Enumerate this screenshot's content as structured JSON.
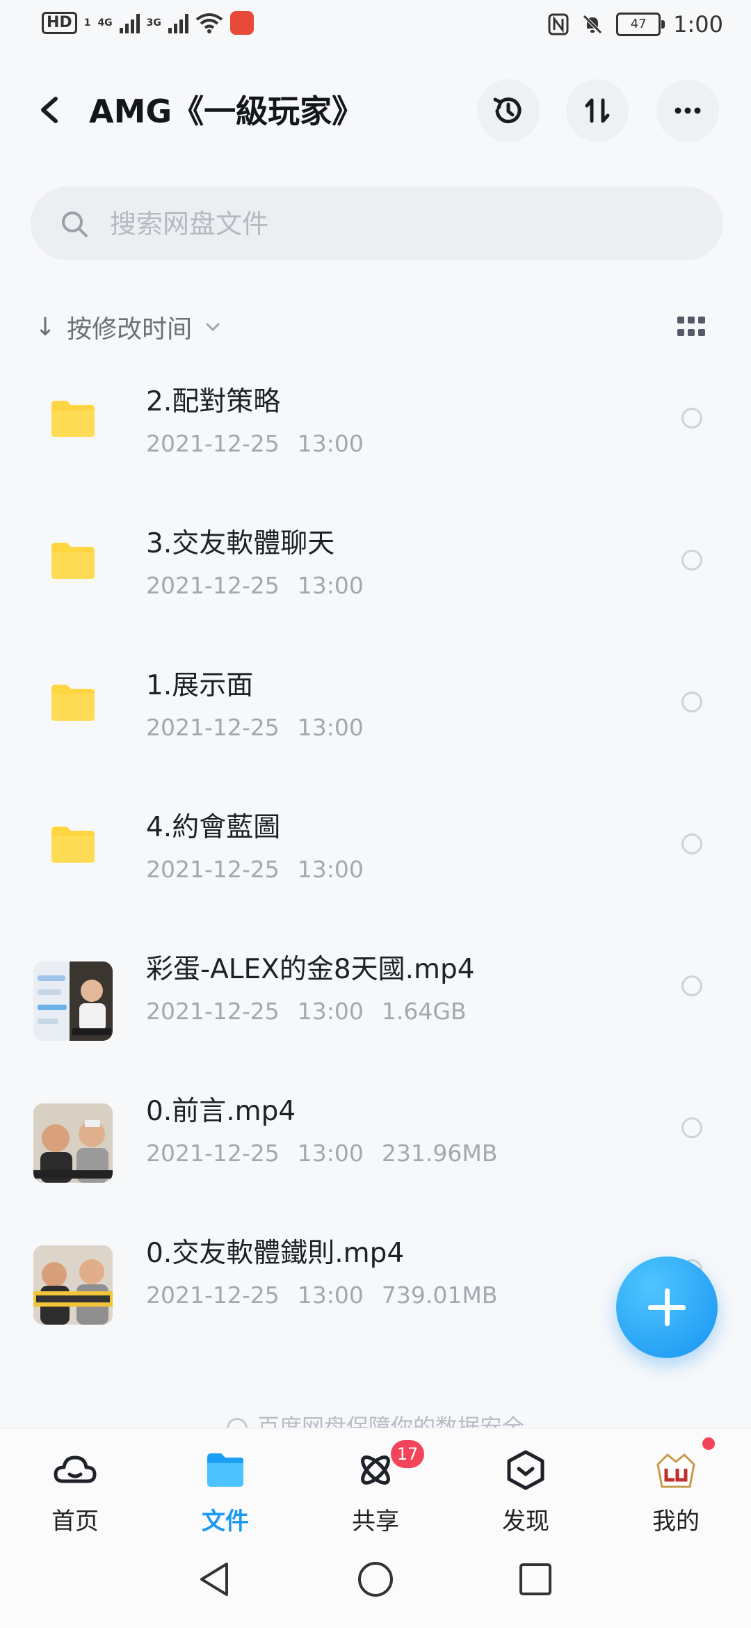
{
  "status_bar": {
    "hd": "HD",
    "sim1": "1",
    "net1": "4G",
    "net2": "3G",
    "battery": "47",
    "time": "1:00"
  },
  "header": {
    "title": "AMG《一級玩家》",
    "back_icon": "chevron-left-icon",
    "history_icon": "history-icon",
    "transfer_icon": "transfer-icon",
    "more_icon": "more-icon"
  },
  "search": {
    "placeholder": "搜索网盘文件"
  },
  "sort": {
    "label": "按修改时间"
  },
  "files": [
    {
      "type": "folder",
      "name": "2.配對策略",
      "date": "2021-12-25",
      "time": "13:00",
      "size": ""
    },
    {
      "type": "folder",
      "name": "3.交友軟體聊天",
      "date": "2021-12-25",
      "time": "13:00",
      "size": ""
    },
    {
      "type": "folder",
      "name": "1.展示面",
      "date": "2021-12-25",
      "time": "13:00",
      "size": ""
    },
    {
      "type": "folder",
      "name": "4.約會藍圖",
      "date": "2021-12-25",
      "time": "13:00",
      "size": ""
    },
    {
      "type": "video",
      "name": "彩蛋-ALEX的金8天國.mp4",
      "date": "2021-12-25",
      "time": "13:00",
      "size": "1.64GB"
    },
    {
      "type": "video",
      "name": "0.前言.mp4",
      "date": "2021-12-25",
      "time": "13:00",
      "size": "231.96MB"
    },
    {
      "type": "video",
      "name": "0.交友軟體鐵則.mp4",
      "date": "2021-12-25",
      "time": "13:00",
      "size": "739.01MB"
    }
  ],
  "footer_note": "百度网盘保障你的数据安全",
  "bottom_nav": [
    {
      "label": "首页",
      "icon": "cloud-home-icon",
      "active": false
    },
    {
      "label": "文件",
      "icon": "folder-icon",
      "active": true
    },
    {
      "label": "共享",
      "icon": "share-atom-icon",
      "active": false,
      "badge": "17"
    },
    {
      "label": "发现",
      "icon": "discover-icon",
      "active": false
    },
    {
      "label": "我的",
      "icon": "avatar-icon",
      "active": false
    }
  ],
  "colors": {
    "accent": "#1a9af5",
    "folder": "#ffd541",
    "badge": "#f2455c"
  }
}
